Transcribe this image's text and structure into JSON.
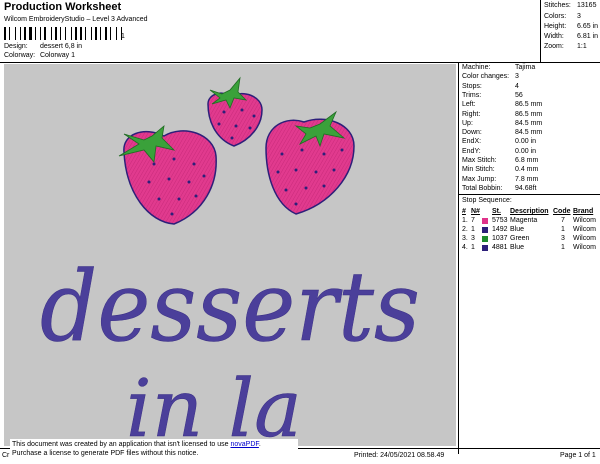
{
  "header": {
    "title": "Production Worksheet",
    "subtitle": "Wilcom EmbroideryStudio – Level 3 Advanced",
    "design_label": "Design:",
    "design_value": "dessert 6,8 in",
    "colorway_label": "Colorway:",
    "colorway_value": "Colorway 1",
    "barcode_suffix": "1"
  },
  "summary": {
    "stitches_label": "Stitches:",
    "stitches": "13165",
    "colors_label": "Colors:",
    "colors": "3",
    "height_label": "Height:",
    "height": "6.65 in",
    "width_label": "Width:",
    "width": "6.81 in",
    "zoom_label": "Zoom:",
    "zoom": "1:1"
  },
  "design_text": {
    "line1": "desserts",
    "line2": "in la"
  },
  "machine_info": [
    {
      "label": "Machine:",
      "value": "Tajima"
    },
    {
      "label": "Color changes:",
      "value": "3"
    },
    {
      "label": "Stops:",
      "value": "4"
    },
    {
      "label": "Trims:",
      "value": "56"
    },
    {
      "label": "Left:",
      "value": "86.5 mm"
    },
    {
      "label": "Right:",
      "value": "86.5 mm"
    },
    {
      "label": "Up:",
      "value": "84.5 mm"
    },
    {
      "label": "Down:",
      "value": "84.5 mm"
    },
    {
      "label": "EndX:",
      "value": "0.00 in"
    },
    {
      "label": "EndY:",
      "value": "0.00 in"
    },
    {
      "label": "Max Stitch:",
      "value": "6.8 mm"
    },
    {
      "label": "Min Stitch:",
      "value": "0.4 mm"
    },
    {
      "label": "Max Jump:",
      "value": "7.8 mm"
    },
    {
      "label": "Total Bobbin:",
      "value": "94.68ft"
    }
  ],
  "stop_sequence": {
    "title": "Stop Sequence:",
    "headers": {
      "num": "#",
      "n": "N#",
      "st": "St.",
      "description": "Description",
      "code": "Code",
      "brand": "Brand"
    },
    "rows": [
      {
        "num": "1.",
        "n": "7",
        "color": "#e0338a",
        "st": "5753",
        "description": "Magenta",
        "code": "7",
        "brand": "Wilcom"
      },
      {
        "num": "2.",
        "n": "1",
        "color": "#2d1f7a",
        "st": "1492",
        "description": "Blue",
        "code": "1",
        "brand": "Wilcom"
      },
      {
        "num": "3.",
        "n": "3",
        "color": "#1f8a2e",
        "st": "1037",
        "description": "Green",
        "code": "3",
        "brand": "Wilcom"
      },
      {
        "num": "4.",
        "n": "1",
        "color": "#2d1f7a",
        "st": "4881",
        "description": "Blue",
        "code": "1",
        "brand": "Wilcom"
      }
    ]
  },
  "footer": {
    "notice_line1": "This document was created by an application that isn't licensed to use ",
    "notice_link": "novaPDF",
    "notice_line1_end": ".",
    "notice_line2": "Purchase a license to generate PDF files without this notice.",
    "cr": "Cr",
    "printed": "Printed: 24/05/2021 08.58.49",
    "page": "Page 1 of 1"
  }
}
